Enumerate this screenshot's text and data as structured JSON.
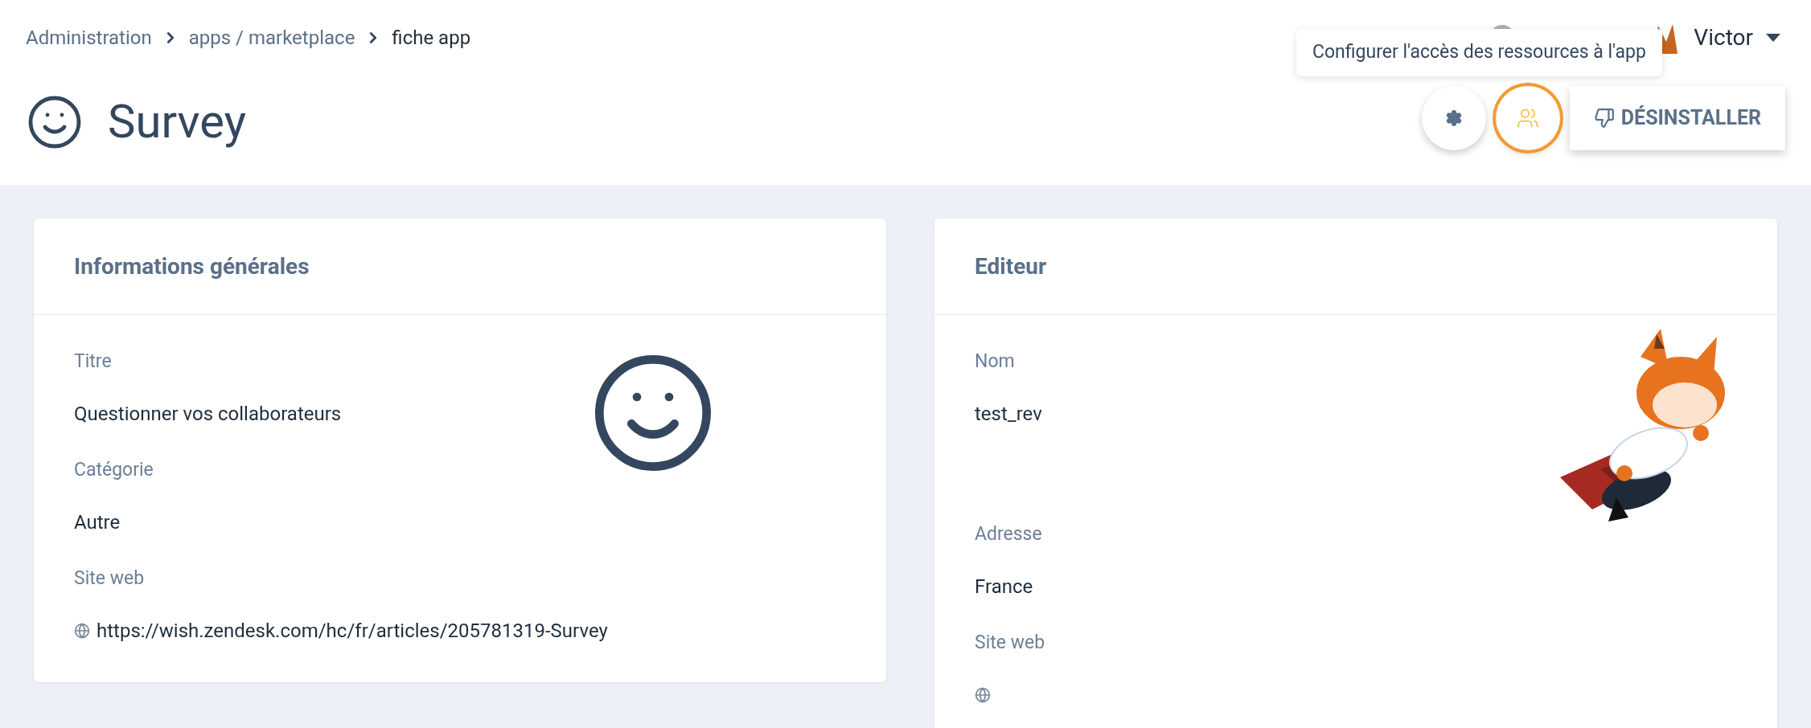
{
  "breadcrumb": [
    {
      "label": "Administration",
      "kind": "link"
    },
    {
      "label": "apps / marketplace",
      "kind": "link"
    },
    {
      "label": "fiche app",
      "kind": "current"
    }
  ],
  "user": {
    "name": "Victor"
  },
  "tooltip": "Configurer l'accès des ressources à l'app",
  "page_title": "Survey",
  "actions": [
    {
      "kind": "settings",
      "focused": false
    },
    {
      "kind": "users",
      "focused": true
    },
    {
      "kind": "uninstall",
      "label": "DÉSINSTALLER",
      "focused": false
    }
  ],
  "cards": [
    {
      "title": "Informations générales",
      "kind": "app",
      "fields": [
        {
          "label": "Titre",
          "value": "Questionner vos collaborateurs"
        },
        {
          "label": "Catégorie",
          "value": "Autre"
        },
        {
          "label": "Site web",
          "value": "https://wish.zendesk.com/hc/fr/articles/205781319-Survey",
          "kind": "link"
        }
      ]
    },
    {
      "title": "Editeur",
      "kind": "publisher",
      "fields": [
        {
          "label": "Nom",
          "value": "test_rev"
        },
        {
          "label": "Adresse",
          "value": "France"
        },
        {
          "label": "Site web",
          "kind": "link"
        }
      ]
    }
  ]
}
